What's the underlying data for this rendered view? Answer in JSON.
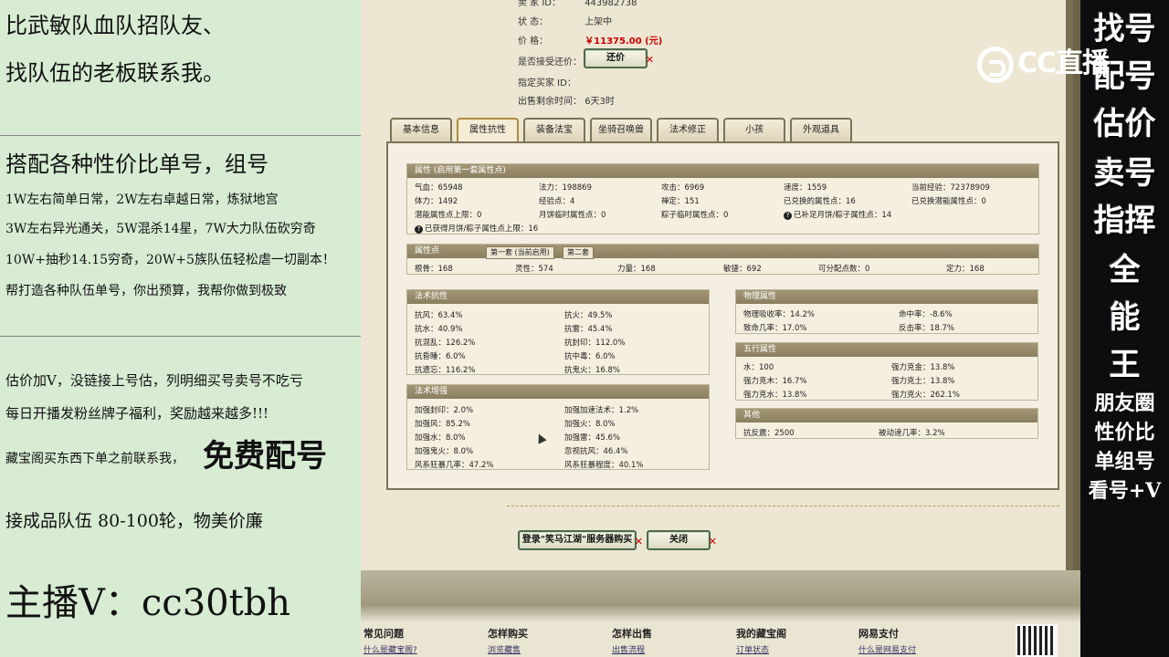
{
  "left_panel": {
    "lines": [
      "比武敏队血队招队友、",
      "找队伍的老板联系我。",
      "搭配各种性价比单号，组号",
      "1W左右简单日常，2W左右卓越日常，炼狱地宫",
      "3W左右异光通关，5W混杀14星，7W大力队伍砍穷奇",
      "10W+抽秒14.15穷奇，20W+5族队伍轻松虐一切副本！",
      "帮打造各种队伍单号，你出预算，我帮你做到极致",
      "估价加V，没链接上号估，列明细买号卖号不吃亏",
      "每日开播发粉丝牌子福利，奖励越来越多!!!",
      "藏宝阁买东西下单之前联系我，",
      "免费配号",
      "接成品队伍 80-100轮，物美价廉",
      "主播V：cc30tbh"
    ]
  },
  "right_panel": {
    "chars": [
      "找号",
      "配号",
      "估价",
      "卖号",
      "指挥",
      "全",
      "能",
      "王"
    ],
    "rows": [
      "朋友圈",
      "性价比",
      "单组号",
      "看号+V"
    ],
    "logo": "CC直播"
  },
  "item_info": {
    "seller_id_label": "卖  家  ID：",
    "seller_id_value": "443982738",
    "status_label": "状        态：",
    "status_value": "上架中",
    "price_label": "价        格：",
    "price_value": "￥11375.00 (元)",
    "counter_label": "是否接受还价：",
    "counter_button": "还价",
    "buyer_id_label": "指定买家 ID：",
    "remaining_label": "出售剩余时间：",
    "remaining_value": "6天3时"
  },
  "tabs": [
    "基本信息",
    "属性抗性",
    "装备法宝",
    "坐骑召唤兽",
    "法术修正",
    "小孩",
    "外观道具"
  ],
  "attributes": {
    "header": "属性 (启用第一套属性点)",
    "rows": [
      [
        "气血：65948",
        "法力：198869",
        "攻击：6969",
        "速度：1559",
        "当前经验：72378909"
      ],
      [
        "体力：1492",
        "经验点：4",
        "禅定：151",
        "已兑换的属性点：16",
        "已兑换潜能属性点：0"
      ],
      [
        "潜能属性点上限：0",
        "月饼临时属性点：0",
        "粽子临时属性点：0",
        "已补足月饼/粽子属性点：14",
        ""
      ],
      [
        "已获得月饼/粽子属性点上限：16"
      ]
    ]
  },
  "points": {
    "header": "属性点",
    "subtab1": "第一套 (当前启用)",
    "subtab2": "第二套",
    "values": [
      "根骨：168",
      "灵性：574",
      "力量：168",
      "敏捷：692",
      "可分配点数：0",
      "定力：168"
    ]
  },
  "resist": {
    "header": "法术抗性",
    "rows": [
      [
        "抗风：63.4%",
        "抗火：49.5%"
      ],
      [
        "抗水：40.9%",
        "抗雷：45.4%"
      ],
      [
        "抗混乱：126.2%",
        "抗封印：112.0%"
      ],
      [
        "抗昏睡：6.0%",
        "抗中毒：6.0%"
      ],
      [
        "抗遗忘：116.2%",
        "抗鬼火：16.8%"
      ]
    ]
  },
  "enhance": {
    "header": "法术增强",
    "rows": [
      [
        "加强封印：2.0%",
        "加强加速法术：1.2%"
      ],
      [
        "加强风：85.2%",
        "加强火：8.0%"
      ],
      [
        "加强水：8.0%",
        "加强雷：45.6%"
      ],
      [
        "加强鬼火：8.0%",
        "忽视抗风：46.4%"
      ],
      [
        "风系狂暴几率：47.2%",
        "风系狂暴程度：40.1%"
      ]
    ]
  },
  "physical": {
    "header": "物理属性",
    "rows": [
      [
        "物理吸收率：14.2%",
        "命中率：-8.6%"
      ],
      [
        "致命几率：17.0%",
        "反击率：18.7%"
      ]
    ]
  },
  "wuxing": {
    "header": "五行属性",
    "rows": [
      [
        "水：100",
        "强力克金：13.8%"
      ],
      [
        "强力克木：16.7%",
        "强力克土：13.8%"
      ],
      [
        "强力克水：13.8%",
        "强力克火：262.1%"
      ]
    ]
  },
  "other": {
    "header": "其他",
    "rows": [
      [
        "抗反震：2500",
        "被动速几率：3.2%"
      ]
    ]
  },
  "buttons": {
    "login": "登录\"笑马江湖\"服务器购买",
    "close": "关闭"
  },
  "footer": {
    "cols": [
      "常见问题",
      "怎样购买",
      "怎样出售",
      "我的藏宝阁",
      "网易支付"
    ],
    "links": [
      "什么是藏宝阁?",
      "浏览藏售",
      "出售流程",
      "订单状态",
      "什么是网易支付"
    ]
  }
}
